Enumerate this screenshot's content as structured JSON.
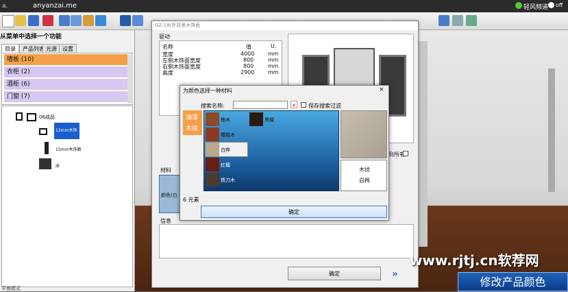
{
  "topbar": {
    "site": "anyanzai.me",
    "prefix": "a.",
    "mode": "轻风频道",
    "toggle": "off"
  },
  "left": {
    "header": "从菜单中选择一个功能",
    "tabs": [
      "目录",
      "产品列表",
      "光源",
      "设置"
    ],
    "categories": [
      {
        "label": "墙板 (10)",
        "color": "#f4a04a"
      },
      {
        "label": "衣柜 (2)",
        "color": "#d6c8f0"
      },
      {
        "label": "酒柜 (6)",
        "color": "#d6c8f0"
      },
      {
        "label": "门窗 (7)",
        "color": "#d6c8f0"
      }
    ],
    "tree": [
      "06成品",
      "12mm木饰面",
      "15mm木饰面",
      "床"
    ],
    "footer": "平面模式"
  },
  "dialog": {
    "title": "GZ-18(外背景木饰面",
    "section": "驱动",
    "param_headers": [
      "名称",
      "值",
      "U."
    ],
    "params": [
      {
        "name": "宽度",
        "value": "4000",
        "unit": "mm"
      },
      {
        "name": "左侧木饰面宽度",
        "value": "800",
        "unit": "mm"
      },
      {
        "name": "右侧木饰面宽度",
        "value": "800",
        "unit": "mm"
      },
      {
        "name": "高度",
        "value": "2900",
        "unit": "mm"
      }
    ],
    "material_label": "材料",
    "material_item": "颜色(白",
    "info_label": "信息",
    "ok": "确定",
    "apply_all": "到所有"
  },
  "material": {
    "title": "为颜色选择一种材料",
    "search_label": "搜索名称:",
    "search_value": "",
    "save_filter": "保存搜索过滤",
    "categories": [
      "油漆",
      "木纹"
    ],
    "swatches": [
      {
        "label": "柚木",
        "color": "#8b4a2a"
      },
      {
        "label": "黑檀",
        "color": "#2a1a14"
      },
      {
        "label": "樱桃木",
        "color": "#8a3a22"
      },
      {
        "label": "白桦",
        "color": "#b8a890"
      },
      {
        "label": "红檀",
        "color": "#6a1e12"
      },
      {
        "label": "铁刀木",
        "color": "#4a3a30"
      }
    ],
    "selected": "白桦",
    "preview_type": "木纹",
    "preview_name": "白桦",
    "count": "6 元素",
    "ok": "确定"
  },
  "overlay": {
    "watermark": "www.rjtj.cn软荐网",
    "banner": "修改产品颜色"
  }
}
